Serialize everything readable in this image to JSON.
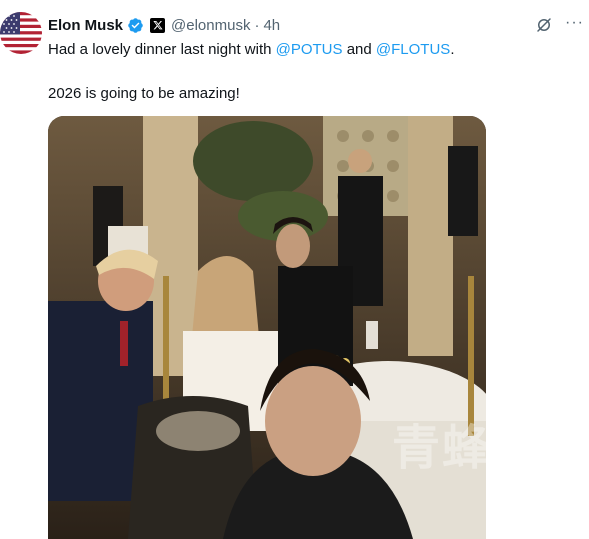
{
  "user": {
    "display_name": "Elon Musk",
    "handle": "@elonmusk",
    "separator": "·",
    "time": "4h",
    "avatar": "us-flag-avatar",
    "verified_badge": "verified-badge-icon",
    "affiliation_badge": "x-logo-icon"
  },
  "actions": {
    "grok_icon": "grok-slash-icon",
    "more_label": "···"
  },
  "tweet": {
    "text_before": "Had a lovely dinner last night with ",
    "mention_1": "@POTUS",
    "text_middle": " and ",
    "mention_2": "@FLOTUS",
    "text_end": ".",
    "line2": "2026 is going to be amazing!"
  },
  "media": {
    "type": "photo",
    "watermark": "青蜂侠"
  },
  "colors": {
    "text": "#0f1419",
    "secondary": "#536471",
    "link": "#1d9bf0",
    "verified": "#1d9bf0"
  }
}
